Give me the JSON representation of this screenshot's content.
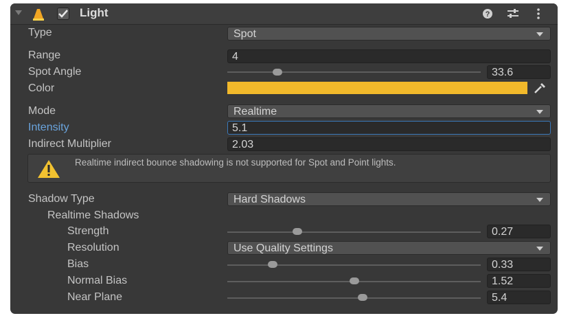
{
  "component": {
    "title": "Light",
    "enabled": true
  },
  "properties": {
    "type": {
      "label": "Type",
      "value": "Spot"
    },
    "range": {
      "label": "Range",
      "value": "4"
    },
    "spot_angle": {
      "label": "Spot Angle",
      "value": "33.6",
      "slider_fraction": 0.21
    },
    "color": {
      "label": "Color",
      "value": "#F2B92B"
    },
    "mode": {
      "label": "Mode",
      "value": "Realtime"
    },
    "intensity": {
      "label": "Intensity",
      "value": "5.1"
    },
    "indirect_multiplier": {
      "label": "Indirect Multiplier",
      "value": "2.03"
    },
    "warning": "Realtime indirect bounce shadowing is not supported for Spot and Point lights.",
    "shadow_type": {
      "label": "Shadow Type",
      "value": "Hard Shadows"
    },
    "realtime_shadows": {
      "label": "Realtime Shadows"
    },
    "strength": {
      "label": "Strength",
      "value": "0.27",
      "slider_fraction": 0.27
    },
    "resolution": {
      "label": "Resolution",
      "value": "Use Quality Settings"
    },
    "bias": {
      "label": "Bias",
      "value": "0.33",
      "slider_fraction": 0.17
    },
    "normal_bias": {
      "label": "Normal Bias",
      "value": "1.52",
      "slider_fraction": 0.51
    },
    "near_plane": {
      "label": "Near Plane",
      "value": "5.4",
      "slider_fraction": 0.54
    }
  },
  "icons": [
    "fold-arrow-icon",
    "light-component-icon",
    "checkmark-icon",
    "help-icon",
    "presets-icon",
    "kebab-menu-icon",
    "eyedropper-icon",
    "warning-icon"
  ],
  "colors": {
    "panel": "#383838",
    "accent_label": "#6AA4DD",
    "focus_border": "#3A79BB",
    "light_color": "#F2B92B"
  }
}
